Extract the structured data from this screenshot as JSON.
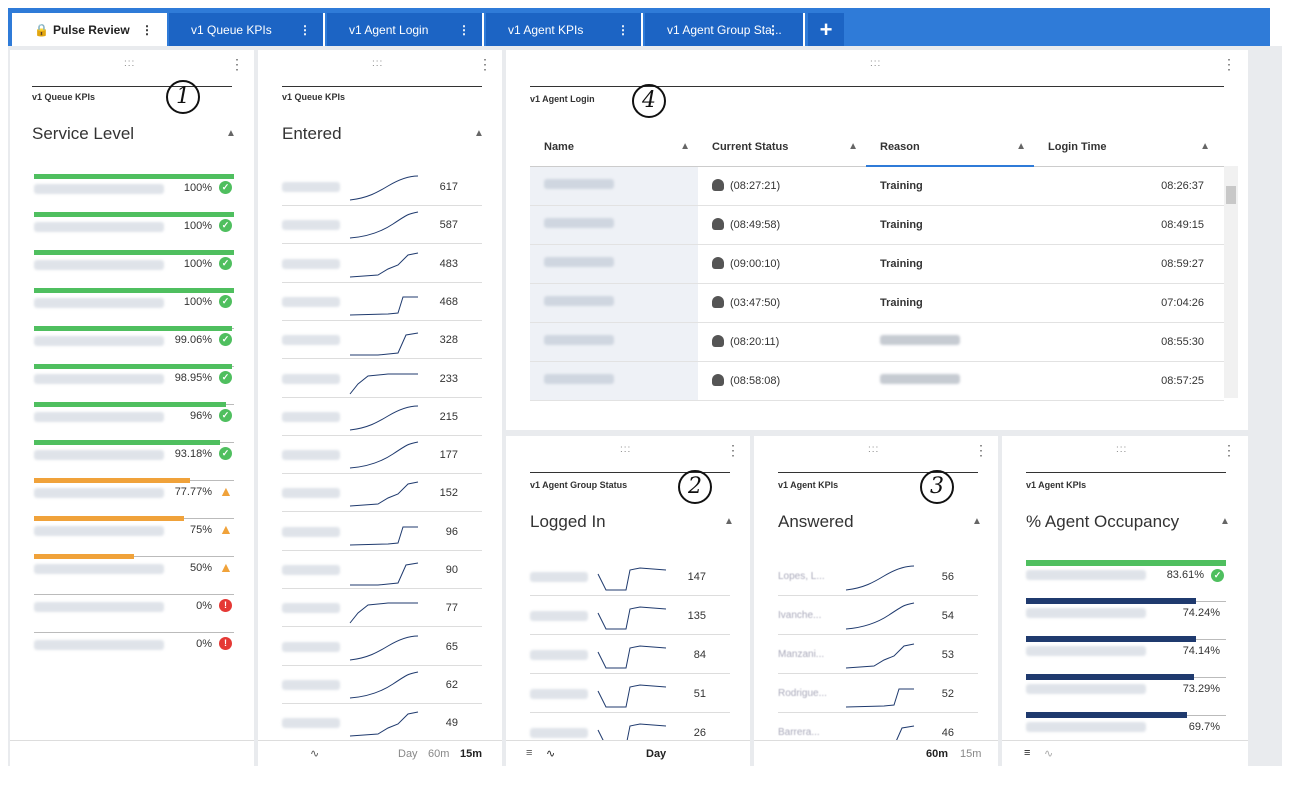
{
  "tabs": [
    {
      "label": "Pulse Review",
      "active": true,
      "locked": true
    },
    {
      "label": "v1 Queue KPIs"
    },
    {
      "label": "v1 Agent Login"
    },
    {
      "label": "v1 Agent KPIs"
    },
    {
      "label": "v1 Agent Group Sta..."
    }
  ],
  "add_tab_label": "+",
  "widget1": {
    "subtitle": "v1 Queue KPIs",
    "title": "Service Level",
    "callout": "1",
    "rows": [
      {
        "value": "100%",
        "fill": 1.0,
        "status": "ok"
      },
      {
        "value": "100%",
        "fill": 1.0,
        "status": "ok"
      },
      {
        "value": "100%",
        "fill": 1.0,
        "status": "ok"
      },
      {
        "value": "100%",
        "fill": 1.0,
        "status": "ok"
      },
      {
        "value": "99.06%",
        "fill": 0.99,
        "status": "ok"
      },
      {
        "value": "98.95%",
        "fill": 0.99,
        "status": "ok"
      },
      {
        "value": "96%",
        "fill": 0.96,
        "status": "ok"
      },
      {
        "value": "93.18%",
        "fill": 0.93,
        "status": "ok"
      },
      {
        "value": "77.77%",
        "fill": 0.78,
        "status": "warn"
      },
      {
        "value": "75%",
        "fill": 0.75,
        "status": "warn"
      },
      {
        "value": "50%",
        "fill": 0.5,
        "status": "warn"
      },
      {
        "value": "0%",
        "fill": 0,
        "status": "err"
      },
      {
        "value": "0%",
        "fill": 0,
        "status": "err"
      }
    ]
  },
  "widget2": {
    "subtitle": "v1 Queue KPIs",
    "title": "Entered",
    "values": [
      "617",
      "587",
      "483",
      "468",
      "328",
      "233",
      "215",
      "177",
      "152",
      "96",
      "90",
      "77",
      "65",
      "62",
      "49"
    ],
    "footer": {
      "day": "Day",
      "m60": "60m",
      "m15": "15m"
    }
  },
  "widget4": {
    "subtitle": "v1 Agent Login",
    "callout": "4",
    "columns": [
      "Name",
      "Current Status",
      "Reason",
      "Login Time"
    ],
    "rows": [
      {
        "status": "(08:27:21)",
        "reason": "Training",
        "login": "08:26:37"
      },
      {
        "status": "(08:49:58)",
        "reason": "Training",
        "login": "08:49:15"
      },
      {
        "status": "(09:00:10)",
        "reason": "Training",
        "login": "08:59:27"
      },
      {
        "status": "(03:47:50)",
        "reason": "Training",
        "login": "07:04:26"
      },
      {
        "status": "(08:20:11)",
        "reason": "",
        "login": "08:55:30"
      },
      {
        "status": "(08:58:08)",
        "reason": "",
        "login": "08:57:25"
      }
    ]
  },
  "widget_group": {
    "subtitle": "v1 Agent Group Status",
    "title": "Logged In",
    "callout": "2",
    "values": [
      "147",
      "135",
      "84",
      "51",
      "26"
    ],
    "footer_day": "Day"
  },
  "widget_answered": {
    "subtitle": "v1 Agent KPIs",
    "title": "Answered",
    "callout": "3",
    "names": [
      "Lopes, L...",
      "Ivanche...",
      "Manzani...",
      "Rodrigue...",
      "Barrera..."
    ],
    "values": [
      "56",
      "54",
      "53",
      "52",
      "46"
    ],
    "footer": {
      "m60": "60m",
      "m15": "15m"
    }
  },
  "widget_occupancy": {
    "subtitle": "v1 Agent KPIs",
    "title": "% Agent Occupancy",
    "rows": [
      {
        "value": "83.61%",
        "fill": 0.84,
        "color": "#4fbf5f",
        "ok": true
      },
      {
        "value": "74.24%",
        "fill": 0.74,
        "color": "#1f3a6e"
      },
      {
        "value": "74.14%",
        "fill": 0.74,
        "color": "#1f3a6e"
      },
      {
        "value": "73.29%",
        "fill": 0.73,
        "color": "#1f3a6e"
      },
      {
        "value": "69.7%",
        "fill": 0.7,
        "color": "#1f3a6e"
      }
    ]
  },
  "colors": {
    "ok": "#4fbf5f",
    "warn": "#f0a23a",
    "err": "#e53935",
    "tabbar": "#2f7bd8",
    "navy": "#1f3a6e"
  }
}
